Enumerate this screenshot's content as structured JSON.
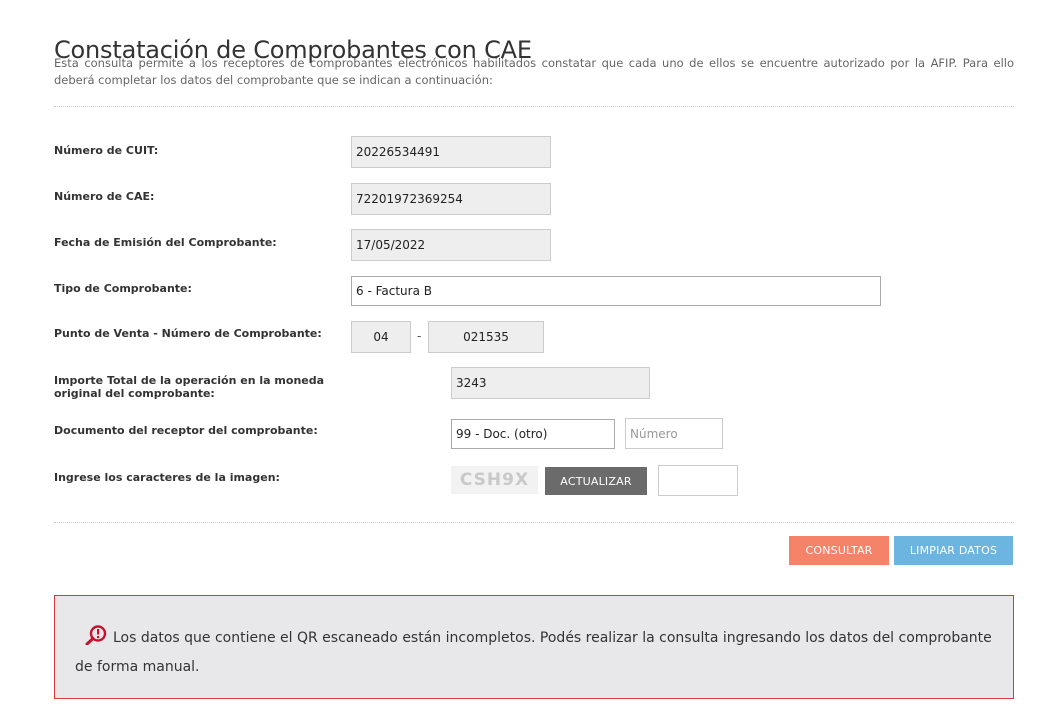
{
  "page": {
    "title": "Constatación de Comprobantes con CAE",
    "description": "Esta consulta permite a los receptores de comprobantes electrónicos habilitados constatar que cada uno de ellos se encuentre autorizado por la AFIP. Para ello deberá completar los datos del comprobante que se indican a continuación:"
  },
  "form": {
    "cuit": {
      "label": "Número de CUIT:",
      "value": "20226534491"
    },
    "cae": {
      "label": "Número de CAE:",
      "value": "72201972369254"
    },
    "fecha": {
      "label": "Fecha de Emisión del Comprobante:",
      "value": "17/05/2022"
    },
    "tipo": {
      "label": "Tipo de Comprobante:",
      "value": "6 - Factura B"
    },
    "punto_venta": {
      "label": "Punto de Venta - Número de Comprobante:",
      "pv_value": "04",
      "separator": "-",
      "numero_value": "021535"
    },
    "importe": {
      "label": "Importe Total de la operación en la moneda original del comprobante:",
      "value": "3243"
    },
    "documento": {
      "label": "Documento del receptor del comprobante:",
      "tipo_value": "99 - Doc. (otro)",
      "numero_placeholder": "Número",
      "numero_value": ""
    },
    "captcha": {
      "label": "Ingrese los caracteres de la imagen:",
      "image_text": "CSH9X",
      "update_label": "ACTUALIZAR",
      "input_value": ""
    }
  },
  "actions": {
    "consultar_label": "CONSULTAR",
    "limpiar_label": "LIMPIAR DATOS"
  },
  "alert": {
    "icon": "search-alert-icon",
    "message": "Los datos que contiene el QR escaneado están incompletos. Podés realizar la consulta ingresando los datos del comprobante de forma manual.",
    "border_color": "#d53b3b"
  },
  "colors": {
    "consultar": "#f4836a",
    "limpiar": "#6cb5e1",
    "actualizar": "#6b6b6b",
    "alert_icon": "#c8102e"
  }
}
